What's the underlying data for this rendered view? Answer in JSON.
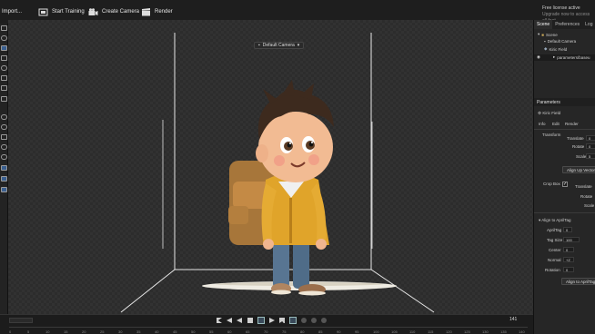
{
  "toolbar": {
    "import_label": "Import...",
    "start_training_label": "Start Training",
    "create_camera_label": "Create Camera",
    "render_label": "Render"
  },
  "license": {
    "line1": "Free license active",
    "line2": "Upgrade now to access all feat"
  },
  "viewport": {
    "camera_selector": "Default Camera"
  },
  "timeline": {
    "frame_count": "141",
    "ticks": [
      "0",
      "5",
      "10",
      "15",
      "20",
      "25",
      "30",
      "35",
      "40",
      "45",
      "50",
      "55",
      "60",
      "65",
      "70",
      "75",
      "80",
      "85",
      "90",
      "95",
      "100",
      "105",
      "110",
      "115",
      "120",
      "125",
      "130",
      "135",
      "140"
    ]
  },
  "panel": {
    "tabs": [
      "Scene",
      "Preferences",
      "Log"
    ],
    "tree": {
      "scene": "Scene",
      "default_camera": "Default Camera",
      "field": "Kiric Field",
      "params_file": "parameters/baseu"
    },
    "params_title": "Parameters",
    "object_name": "Kiric Field",
    "subtabs": [
      "Info",
      "Edit",
      "Render"
    ],
    "transform_label": "Transform",
    "translate_label": "Translate",
    "rotate_label": "Rotate",
    "scale_label": "Scale",
    "translate_value": "0",
    "rotate_value": "0",
    "scale_value": "5",
    "align_up_button": "Align Up Vector",
    "crop_box_label": "Crop Box",
    "crop_translate_label": "Translate",
    "crop_rotate_label": "Rotate",
    "crop_scale_label": "Scale",
    "align_section": "Align to AprilTag",
    "apriltag_label": "AprilTag",
    "apriltag_value": "0",
    "tag_size_label": "Tag Size",
    "tag_size_value": "100",
    "center_label": "Center",
    "center_value": "0",
    "normal_label": "Normal",
    "normal_value": "+Z",
    "rotation_label": "Rotation",
    "rotation_value": "0",
    "align_apriltag_button": "Align to AprilTag"
  },
  "colors": {
    "background": "#1b1b1b",
    "viewport": "#323232",
    "panel": "#262626",
    "accent": "#5a8fd0"
  }
}
